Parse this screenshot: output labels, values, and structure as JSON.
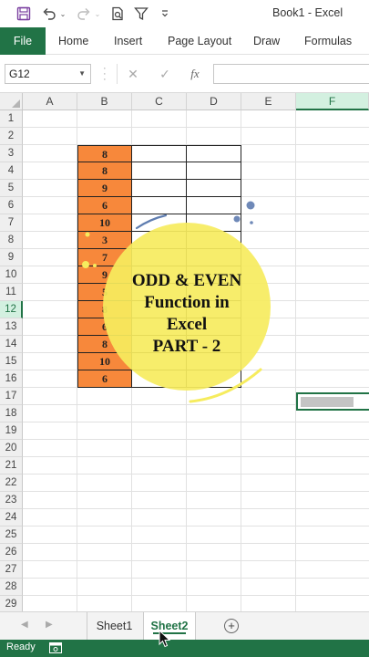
{
  "window": {
    "title": "Book1  -  Excel"
  },
  "ribbon": {
    "tabs": [
      "File",
      "Home",
      "Insert",
      "Page Layout",
      "Draw",
      "Formulas"
    ]
  },
  "formula_bar": {
    "name_box": "G12",
    "fx_label": "fx",
    "formula": ""
  },
  "grid": {
    "columns": [
      "A",
      "B",
      "C",
      "D",
      "E",
      "F"
    ],
    "rows": [
      "1",
      "2",
      "3",
      "4",
      "5",
      "6",
      "7",
      "8",
      "9",
      "10",
      "11",
      "12",
      "13",
      "14",
      "15",
      "16",
      "17",
      "18",
      "19",
      "20",
      "21",
      "22",
      "23",
      "24",
      "25",
      "26",
      "27",
      "28",
      "29"
    ],
    "b_values": [
      "8",
      "8",
      "9",
      "6",
      "10",
      "3",
      "7",
      "9",
      "5",
      "8",
      "6",
      "8",
      "10",
      "6"
    ],
    "selected_cell": "G12"
  },
  "overlay": {
    "lines": [
      "ODD & EVEN",
      "Function in",
      "Excel",
      "PART - 2"
    ],
    "circle_color": "#f6ec5e"
  },
  "sheets": {
    "tabs": [
      "Sheet1",
      "Sheet2"
    ],
    "active": "Sheet2"
  },
  "status": {
    "text": "Ready"
  },
  "colors": {
    "accent": "#217346",
    "highlight": "#f7883b"
  }
}
